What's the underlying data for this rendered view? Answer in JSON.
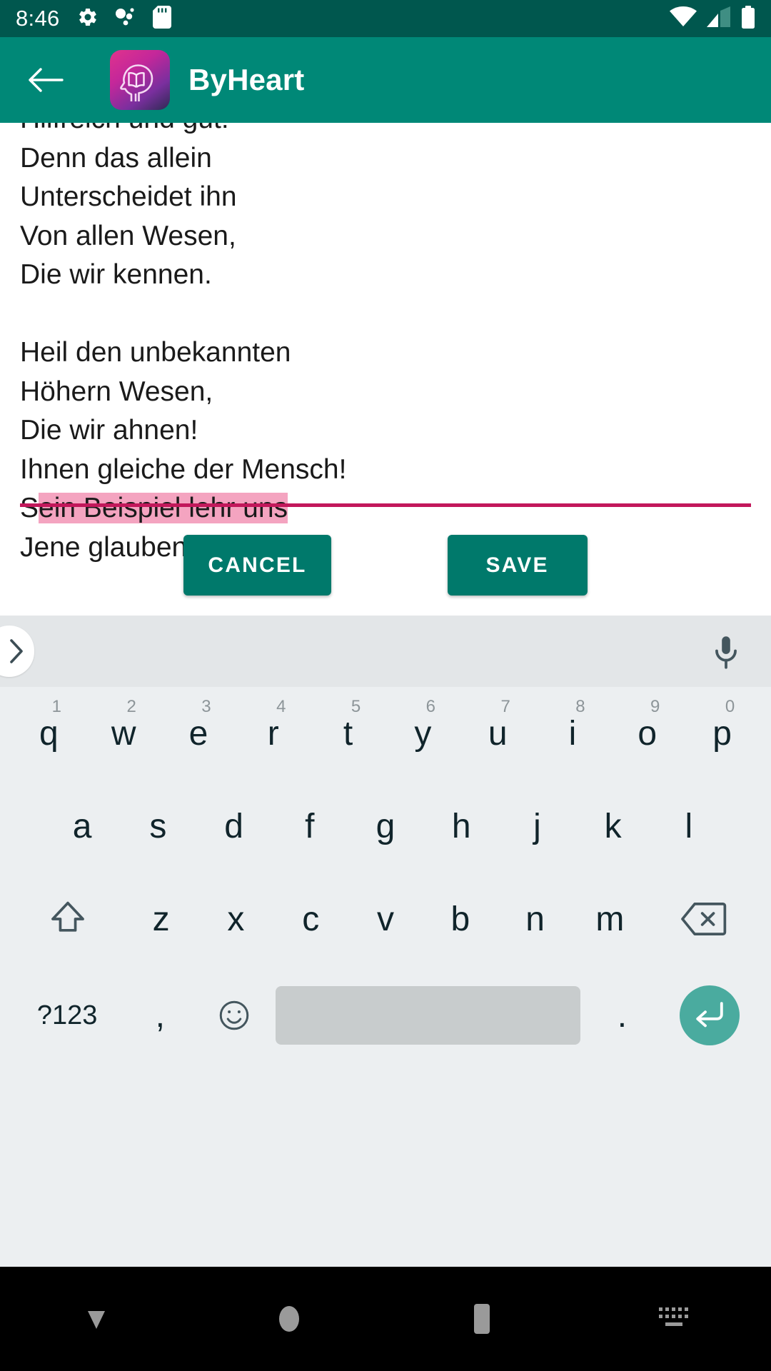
{
  "status_bar": {
    "clock": "8:46",
    "left_icons": [
      "gear-icon",
      "bubbles-icon",
      "sd-card-icon"
    ],
    "right_icons": [
      "wifi-icon",
      "cell-signal-icon",
      "battery-icon"
    ],
    "background_color": "#00574e"
  },
  "app_bar": {
    "back_label": "back-arrow",
    "logo_name": "byheart-logo",
    "title": "ByHeart",
    "background_color": "#008877"
  },
  "editor": {
    "lines": [
      "Hilfreich und gut!",
      "Denn das allein",
      "Unterscheidet ihn",
      "Von allen Wesen,",
      "Die wir kennen.",
      "",
      "Heil den unbekannten",
      "Höhern Wesen,",
      "Die wir ahnen!",
      "Ihnen gleiche der Mensch!",
      "Sein Beispiel lehr uns",
      "Jene glauben."
    ],
    "selection": {
      "line_index": 10,
      "text": "ein Beispiel lehr uns",
      "prefix": "S",
      "highlight_color": "#f4a4c0"
    },
    "underline_color": "#c2185b",
    "text_color": "#1a1a1a"
  },
  "actions": {
    "cancel_label": "CANCEL",
    "save_label": "SAVE",
    "button_color": "#00796b"
  },
  "keyboard": {
    "suggestion_bar": {
      "expand_icon": "chevron-right-icon",
      "mic_icon": "microphone-icon"
    },
    "row1": [
      {
        "key": "q",
        "hint": "1"
      },
      {
        "key": "w",
        "hint": "2"
      },
      {
        "key": "e",
        "hint": "3"
      },
      {
        "key": "r",
        "hint": "4"
      },
      {
        "key": "t",
        "hint": "5"
      },
      {
        "key": "y",
        "hint": "6"
      },
      {
        "key": "u",
        "hint": "7"
      },
      {
        "key": "i",
        "hint": "8"
      },
      {
        "key": "o",
        "hint": "9"
      },
      {
        "key": "p",
        "hint": "0"
      }
    ],
    "row2": [
      "a",
      "s",
      "d",
      "f",
      "g",
      "h",
      "j",
      "k",
      "l"
    ],
    "row3": [
      "z",
      "x",
      "c",
      "v",
      "b",
      "n",
      "m"
    ],
    "shift_icon": "shift-arrow-icon",
    "backspace_icon": "backspace-icon",
    "row4": {
      "symbols_label": "?123",
      "comma_label": ",",
      "emoji_icon": "emoji-smiley-icon",
      "space_label": "",
      "period_label": ".",
      "enter_icon": "enter-return-icon",
      "enter_color": "#4aab9f"
    }
  },
  "nav_bar": {
    "back_icon": "hide-keyboard-triangle-icon",
    "home_icon": "home-circle-icon",
    "recents_icon": "recents-square-icon",
    "keyboard_icon": "keyboard-switch-icon"
  }
}
